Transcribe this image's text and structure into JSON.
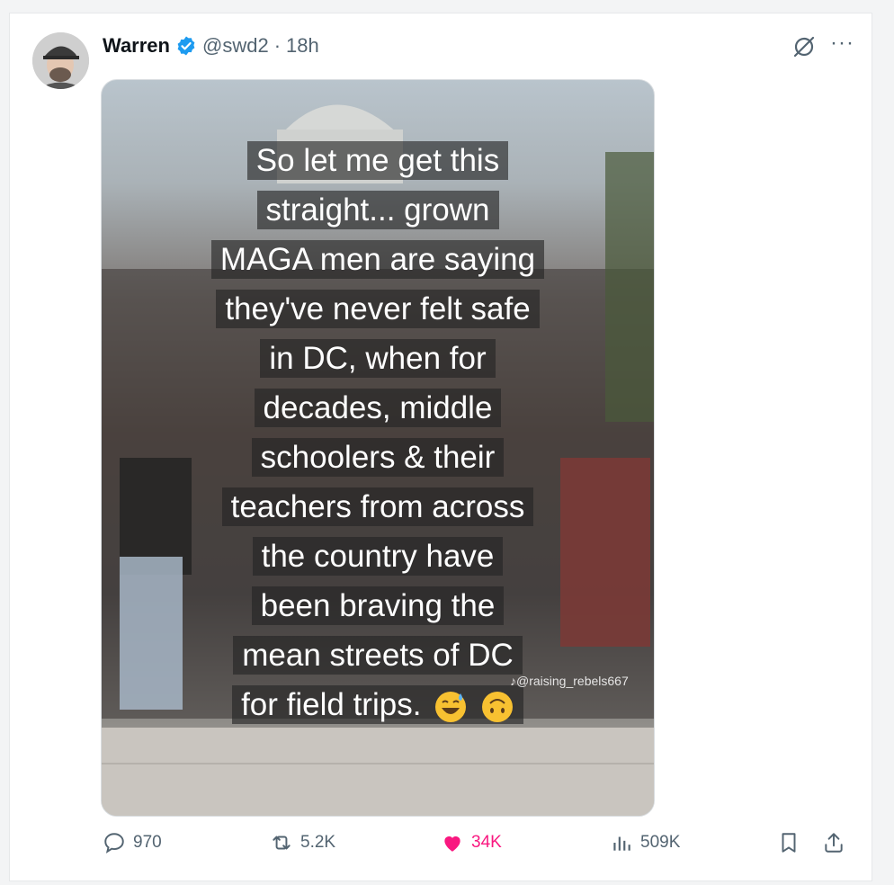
{
  "post": {
    "author_name": "Warren",
    "handle": "@swd2",
    "separator": "·",
    "time": "18h"
  },
  "media": {
    "lines": [
      "So let me get this",
      "straight... grown",
      "MAGA men are saying",
      "they've never felt safe",
      "in DC, when for",
      "decades, middle",
      "schoolers & their",
      "teachers from across",
      "the country have",
      "been braving the",
      "mean streets of DC",
      "for field trips."
    ],
    "watermark": "@raising_rebels667"
  },
  "actions": {
    "replies": "970",
    "reposts": "5.2K",
    "likes": "34K",
    "views": "509K"
  },
  "colors": {
    "verified": "#1d9bf0",
    "like": "#f91880",
    "muted": "#536471"
  },
  "icons": [
    "verified-badge-icon",
    "grok-icon",
    "more-icon",
    "reply-icon",
    "repost-icon",
    "heart-icon",
    "views-icon",
    "bookmark-icon",
    "share-icon"
  ]
}
